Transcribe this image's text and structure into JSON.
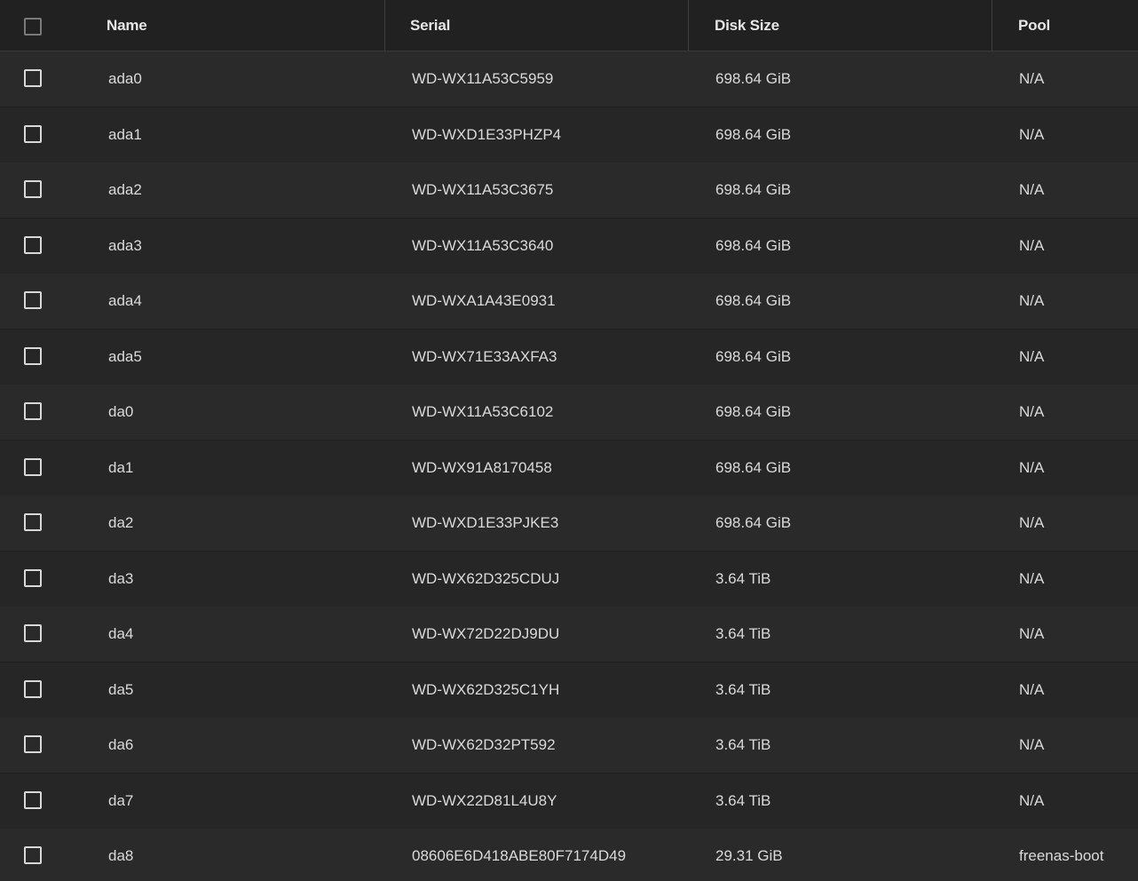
{
  "table": {
    "columns": {
      "name": "Name",
      "serial": "Serial",
      "disk_size": "Disk Size",
      "pool": "Pool"
    },
    "rows": [
      {
        "name": "ada0",
        "serial": "WD-WX11A53C5959",
        "disk_size": "698.64 GiB",
        "pool": "N/A"
      },
      {
        "name": "ada1",
        "serial": "WD-WXD1E33PHZP4",
        "disk_size": "698.64 GiB",
        "pool": "N/A"
      },
      {
        "name": "ada2",
        "serial": "WD-WX11A53C3675",
        "disk_size": "698.64 GiB",
        "pool": "N/A"
      },
      {
        "name": "ada3",
        "serial": "WD-WX11A53C3640",
        "disk_size": "698.64 GiB",
        "pool": "N/A"
      },
      {
        "name": "ada4",
        "serial": "WD-WXA1A43E0931",
        "disk_size": "698.64 GiB",
        "pool": "N/A"
      },
      {
        "name": "ada5",
        "serial": "WD-WX71E33AXFA3",
        "disk_size": "698.64 GiB",
        "pool": "N/A"
      },
      {
        "name": "da0",
        "serial": "WD-WX11A53C6102",
        "disk_size": "698.64 GiB",
        "pool": "N/A"
      },
      {
        "name": "da1",
        "serial": "WD-WX91A8170458",
        "disk_size": "698.64 GiB",
        "pool": "N/A"
      },
      {
        "name": "da2",
        "serial": "WD-WXD1E33PJKE3",
        "disk_size": "698.64 GiB",
        "pool": "N/A"
      },
      {
        "name": "da3",
        "serial": "WD-WX62D325CDUJ",
        "disk_size": "3.64 TiB",
        "pool": "N/A"
      },
      {
        "name": "da4",
        "serial": "WD-WX72D22DJ9DU",
        "disk_size": "3.64 TiB",
        "pool": "N/A"
      },
      {
        "name": "da5",
        "serial": "WD-WX62D325C1YH",
        "disk_size": "3.64 TiB",
        "pool": "N/A"
      },
      {
        "name": "da6",
        "serial": "WD-WX62D32PT592",
        "disk_size": "3.64 TiB",
        "pool": "N/A"
      },
      {
        "name": "da7",
        "serial": "WD-WX22D81L4U8Y",
        "disk_size": "3.64 TiB",
        "pool": "N/A"
      },
      {
        "name": "da8",
        "serial": "08606E6D418ABE80F7174D49",
        "disk_size": "29.31 GiB",
        "pool": "freenas-boot"
      }
    ]
  }
}
